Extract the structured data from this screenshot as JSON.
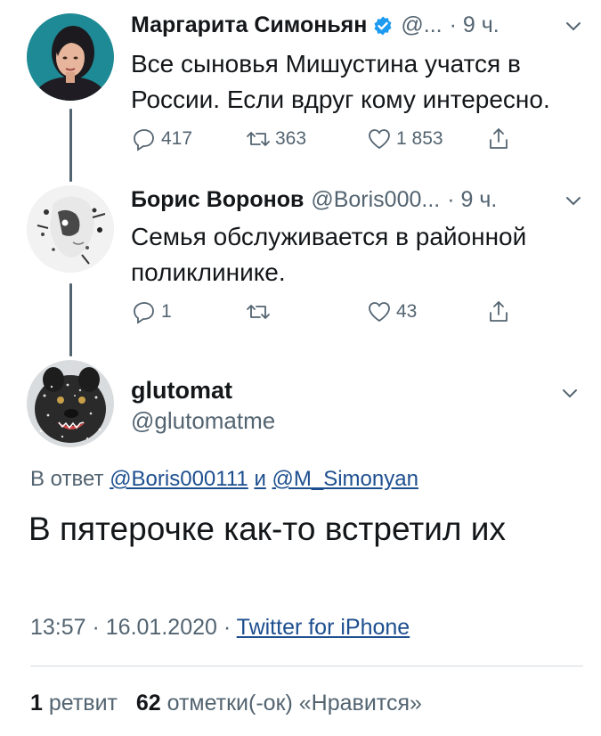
{
  "tweets": [
    {
      "name": "Маргарита Симоньян",
      "handle": "@...",
      "time": "· 9 ч.",
      "text": "Все сыновья Мишустина учатся в России. Если вдруг кому интересно.",
      "replies": "417",
      "retweets": "363",
      "likes": "1 853",
      "verified": true
    },
    {
      "name": "Борис Воронов",
      "handle": "@Boris000...",
      "time": "· 9 ч.",
      "text": "Семья обслуживается в районной поликлинике.",
      "replies": "1",
      "retweets": "",
      "likes": "43",
      "verified": false
    }
  ],
  "main": {
    "name": "glutomat",
    "handle": "@glutomatme",
    "reply_prefix": "В ответ",
    "reply_mention_1": "@Boris000111",
    "reply_and": "и",
    "reply_mention_2": "@M_Simonyan",
    "text": "В пятерочке как-то встретил их",
    "timestamp": "13:57 · 16.01.2020 ·",
    "source": "Twitter for iPhone",
    "retweet_count": "1",
    "retweet_label": "ретвит",
    "like_count": "62",
    "like_label": "отметки(-ок) «Нравится»"
  },
  "colors": {
    "text": "#14171a",
    "secondary": "#536471",
    "link": "#1d4f8f",
    "verified": "#1d9bf0"
  }
}
